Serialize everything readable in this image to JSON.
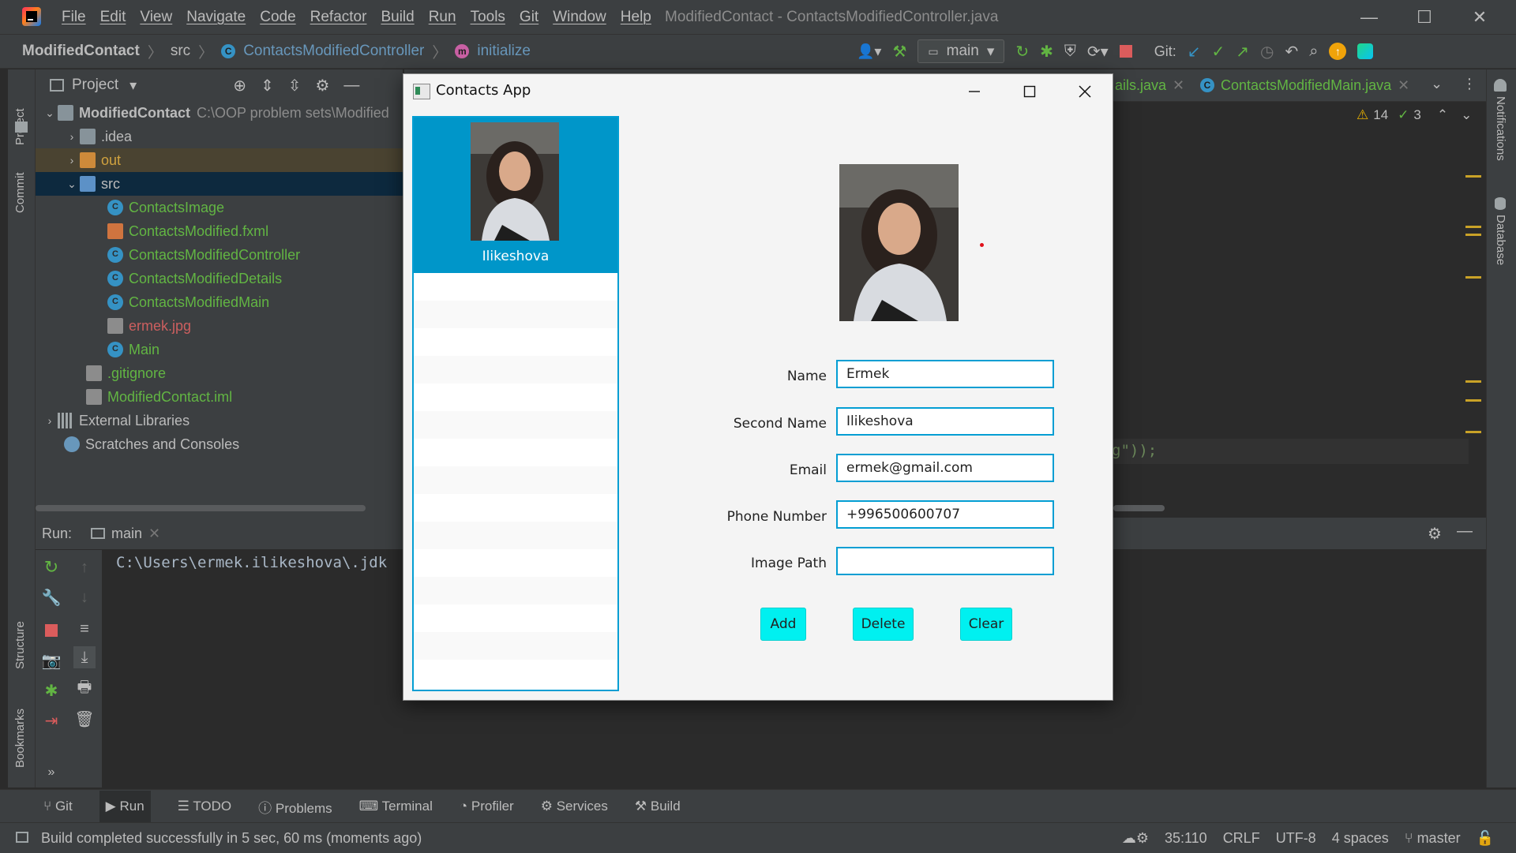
{
  "ide": {
    "menu": [
      "File",
      "Edit",
      "View",
      "Navigate",
      "Code",
      "Refactor",
      "Build",
      "Run",
      "Tools",
      "Git",
      "Window",
      "Help"
    ],
    "window_title": "ModifiedContact - ContactsModifiedController.java",
    "breadcrumbs": {
      "project": "ModifiedContact",
      "folder": "src",
      "class": "ContactsModifiedController",
      "method": "initialize"
    },
    "run_config": "main",
    "git_label": "Git:",
    "project_panel": {
      "title": "Project",
      "tree": [
        {
          "label": "ModifiedContact",
          "extra": "C:\\OOP problem sets\\Modified",
          "bold": true
        },
        {
          "label": ".idea"
        },
        {
          "label": "out"
        },
        {
          "label": "src"
        },
        {
          "label": "ContactsImage"
        },
        {
          "label": "ContactsModified.fxml"
        },
        {
          "label": "ContactsModifiedController"
        },
        {
          "label": "ContactsModifiedDetails"
        },
        {
          "label": "ContactsModifiedMain"
        },
        {
          "label": "ermek.jpg"
        },
        {
          "label": "Main"
        },
        {
          "label": ".gitignore"
        },
        {
          "label": "ModifiedContact.iml"
        },
        {
          "label": "External Libraries"
        },
        {
          "label": "Scratches and Consoles"
        }
      ]
    },
    "editor_tabs": [
      "ails.java",
      "ContactsModifiedMain.java"
    ],
    "inspections": {
      "warnings": "14",
      "ok": "3"
    },
    "code_fragment": "g\"));",
    "left_strip": {
      "project": "Project",
      "commit": "Commit",
      "structure": "Structure",
      "bookmarks": "Bookmarks"
    },
    "right_strip": {
      "notifications": "Notifications",
      "database": "Database"
    },
    "run_panel": {
      "label": "Run:",
      "tab": "main",
      "console_line": "C:\\Users\\ermek.ilikeshova\\.jdk"
    },
    "bottom_tools": [
      "Git",
      "Run",
      "TODO",
      "Problems",
      "Terminal",
      "Profiler",
      "Services",
      "Build"
    ],
    "status": {
      "message": "Build completed successfully in 5 sec, 60 ms (moments ago)",
      "position": "35:110",
      "line_sep": "CRLF",
      "encoding": "UTF-8",
      "indent": "4 spaces",
      "branch": "master"
    }
  },
  "app": {
    "title": "Contacts App",
    "contacts": [
      {
        "name": "Ilikeshova",
        "selected": true
      }
    ],
    "form": {
      "name_label": "Name",
      "name_value": "Ermek",
      "second_name_label": "Second Name",
      "second_name_value": "Ilikeshova",
      "email_label": "Email",
      "email_value": "ermek@gmail.com",
      "phone_label": "Phone Number",
      "phone_value": "+996500600707",
      "image_path_label": "Image Path",
      "image_path_value": ""
    },
    "buttons": {
      "add": "Add",
      "delete": "Delete",
      "clear": "Clear"
    }
  },
  "colors": {
    "ide_bg": "#2b2b2b",
    "ide_panel": "#3c3f41",
    "accent_blue": "#039ed3",
    "selected_row": "#0096c9",
    "button_cyan": "#00f0f0",
    "file_green": "#62b543",
    "file_orange": "#d0743f",
    "file_red": "#cc5f5f"
  }
}
